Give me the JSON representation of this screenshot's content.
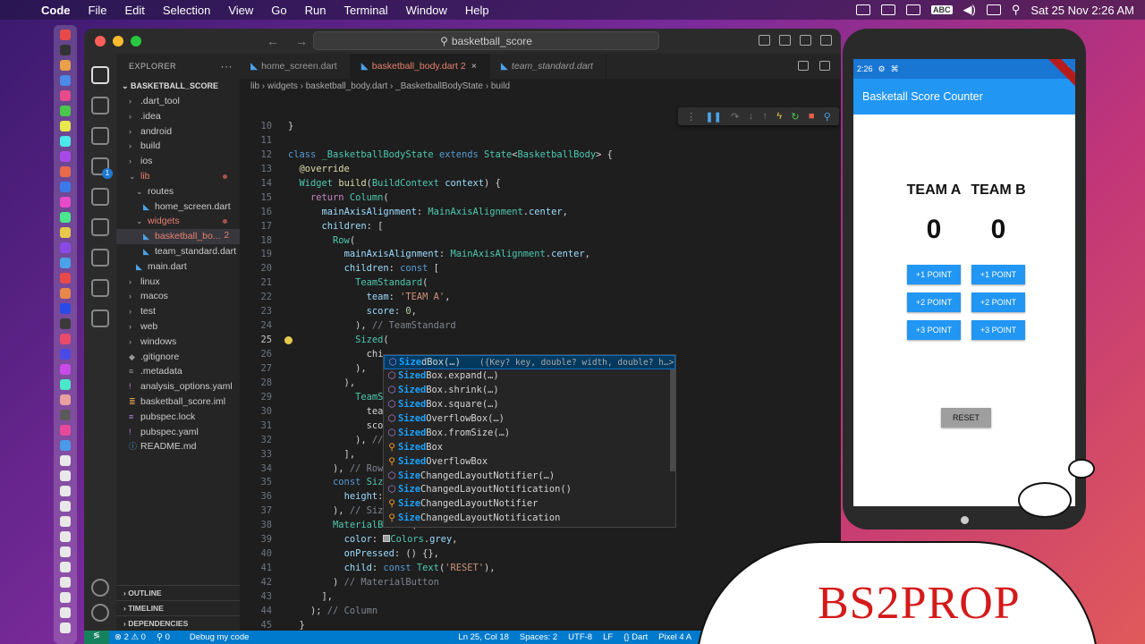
{
  "menubar": {
    "app": "Code",
    "items": [
      "File",
      "Edit",
      "Selection",
      "View",
      "Go",
      "Run",
      "Terminal",
      "Window",
      "Help"
    ],
    "input_source": "ABC",
    "datetime": "Sat 25 Nov  2:26 AM"
  },
  "window": {
    "search": "basketball_score"
  },
  "activity_badge": "1",
  "explorer": {
    "title": "EXPLORER",
    "root": "BASKETBALL_SCORE",
    "items": [
      {
        "label": ".dart_tool",
        "type": "folder",
        "indent": 1
      },
      {
        "label": ".idea",
        "type": "folder",
        "indent": 1
      },
      {
        "label": "android",
        "type": "folder",
        "indent": 1
      },
      {
        "label": "build",
        "type": "folder",
        "indent": 1
      },
      {
        "label": "ios",
        "type": "folder",
        "indent": 1
      },
      {
        "label": "lib",
        "type": "folder-open",
        "indent": 1,
        "modified": true
      },
      {
        "label": "routes",
        "type": "folder-open",
        "indent": 2
      },
      {
        "label": "home_screen.dart",
        "type": "dart",
        "indent": 3
      },
      {
        "label": "widgets",
        "type": "folder-open",
        "indent": 2,
        "modified": true
      },
      {
        "label": "basketball_bo...",
        "type": "dart",
        "indent": 3,
        "selected": true,
        "errors": "2"
      },
      {
        "label": "team_standard.dart",
        "type": "dart",
        "indent": 3
      },
      {
        "label": "main.dart",
        "type": "dart",
        "indent": 2
      },
      {
        "label": "linux",
        "type": "folder",
        "indent": 1
      },
      {
        "label": "macos",
        "type": "folder",
        "indent": 1
      },
      {
        "label": "test",
        "type": "folder",
        "indent": 1
      },
      {
        "label": "web",
        "type": "folder",
        "indent": 1
      },
      {
        "label": "windows",
        "type": "folder",
        "indent": 1
      },
      {
        "label": ".gitignore",
        "type": "git",
        "indent": 1
      },
      {
        "label": ".metadata",
        "type": "meta",
        "indent": 1
      },
      {
        "label": "analysis_options.yaml",
        "type": "yaml",
        "indent": 1
      },
      {
        "label": "basketball_score.iml",
        "type": "iml",
        "indent": 1
      },
      {
        "label": "pubspec.lock",
        "type": "lock",
        "indent": 1
      },
      {
        "label": "pubspec.yaml",
        "type": "yaml",
        "indent": 1
      },
      {
        "label": "README.md",
        "type": "info",
        "indent": 1
      }
    ],
    "sections": [
      "OUTLINE",
      "TIMELINE",
      "DEPENDENCIES"
    ]
  },
  "tabs": [
    {
      "label": "home_screen.dart",
      "active": false,
      "italic": false
    },
    {
      "label": "basketball_body.dart 2",
      "active": true,
      "italic": false
    },
    {
      "label": "team_standard.dart",
      "active": false,
      "italic": true
    }
  ],
  "breadcrumb": [
    "lib",
    "widgets",
    "basketball_body.dart",
    "_BasketballBodyState",
    "build"
  ],
  "code_lines": [
    {
      "n": "10",
      "html": "<span>}</span>"
    },
    {
      "n": "11",
      "html": ""
    },
    {
      "n": "12",
      "html": "<span class='b'>class</span> <span class='t'>_BasketballBodyState</span> <span class='b'>extends</span> <span class='t'>State</span>&lt;<span class='t'>BasketballBody</span>&gt; {"
    },
    {
      "n": "13",
      "html": "  <span class='f'>@override</span>"
    },
    {
      "n": "14",
      "html": "  <span class='t'>Widget</span> <span class='f'>build</span>(<span class='t'>BuildContext</span> <span class='p'>context</span>) {"
    },
    {
      "n": "15",
      "html": "    <span class='k'>return</span> <span class='t'>Column</span>("
    },
    {
      "n": "16",
      "html": "      <span class='p'>mainAxisAlignment</span>: <span class='t'>MainAxisAlignment</span>.<span class='p'>center</span>,"
    },
    {
      "n": "17",
      "html": "      <span class='p'>children</span>: ["
    },
    {
      "n": "18",
      "html": "        <span class='t'>Row</span>("
    },
    {
      "n": "19",
      "html": "          <span class='p'>mainAxisAlignment</span>: <span class='t'>MainAxisAlignment</span>.<span class='p'>center</span>,"
    },
    {
      "n": "20",
      "html": "          <span class='p'>children</span>: <span class='b'>const</span> ["
    },
    {
      "n": "21",
      "html": "            <span class='t'>TeamStandard</span>("
    },
    {
      "n": "22",
      "html": "              <span class='p'>team</span>: <span class='s'>'TEAM A'</span>,"
    },
    {
      "n": "23",
      "html": "              <span class='p'>score</span>: <span class='n'>0</span>,"
    },
    {
      "n": "24",
      "html": "            ), <span class='cm'>// TeamStandard</span>"
    },
    {
      "n": "25",
      "html": "            <span class='t'>Sized</span>("
    },
    {
      "n": "26",
      "html": "              chi"
    },
    {
      "n": "27",
      "html": "            ),"
    },
    {
      "n": "28",
      "html": "          ),"
    },
    {
      "n": "29",
      "html": "            <span class='t'>TeamS</span>"
    },
    {
      "n": "30",
      "html": "              tea"
    },
    {
      "n": "31",
      "html": "              sco"
    },
    {
      "n": "32",
      "html": "            ), <span class='cm'>//</span>"
    },
    {
      "n": "33",
      "html": "          ],"
    },
    {
      "n": "34",
      "html": "        ), <span class='cm'>// Row</span>"
    },
    {
      "n": "35",
      "html": "        <span class='b'>const</span> <span class='t'>Siz</span>"
    },
    {
      "n": "36",
      "html": "          <span class='p'>height</span>:"
    },
    {
      "n": "37",
      "html": "        ), <span class='cm'>// Siz</span>"
    },
    {
      "n": "38",
      "html": "        <span class='t'>MaterialButton</span>("
    },
    {
      "n": "39",
      "html": "          <span class='p'>color</span>: <span style='display:inline-block;width:8px;height:8px;background:#9e9e9e;border:1px solid #ccc;'></span><span class='t'>Colors</span>.<span class='p'>grey</span>,"
    },
    {
      "n": "40",
      "html": "          <span class='p'>onPressed</span>: () {},"
    },
    {
      "n": "41",
      "html": "          <span class='p'>child</span>: <span class='b'>const</span> <span class='t'>Text</span>(<span class='s'>'RESET'</span>),"
    },
    {
      "n": "42",
      "html": "        ) <span class='cm'>// MaterialButton</span>"
    },
    {
      "n": "43",
      "html": "      ],"
    },
    {
      "n": "44",
      "html": "    ); <span class='cm'>// Column</span>"
    },
    {
      "n": "45",
      "html": "  }"
    },
    {
      "n": "46",
      "html": "}"
    }
  ],
  "current_line": "25",
  "suggestions": [
    {
      "match": "Size",
      "rest": "dBox(…)",
      "kind": "method",
      "detail": "({Key? key, double? width, double? h…>",
      "selected": true
    },
    {
      "match": "Sized",
      "rest": "Box.expand(…)",
      "kind": "method"
    },
    {
      "match": "Sized",
      "rest": "Box.shrink(…)",
      "kind": "method"
    },
    {
      "match": "Sized",
      "rest": "Box.square(…)",
      "kind": "method"
    },
    {
      "match": "Sized",
      "rest": "OverflowBox(…)",
      "kind": "method"
    },
    {
      "match": "Sized",
      "rest": "Box.fromSize(…)",
      "kind": "method"
    },
    {
      "match": "Sized",
      "rest": "Box",
      "kind": "class"
    },
    {
      "match": "Sized",
      "rest": "OverflowBox",
      "kind": "class"
    },
    {
      "match": "Size",
      "rest": "ChangedLayoutNotifier(…)",
      "kind": "method"
    },
    {
      "match": "Size",
      "rest": "ChangedLayoutNotification()",
      "kind": "method"
    },
    {
      "match": "Size",
      "rest": "ChangedLayoutNotifier",
      "kind": "class"
    },
    {
      "match": "Size",
      "rest": "ChangedLayoutNotification",
      "kind": "class"
    }
  ],
  "statusbar": {
    "problems": "⊗ 2 ⚠ 0",
    "ports": "⚲ 0",
    "debug": "Debug my code",
    "position": "Ln 25, Col 18",
    "spaces": "Spaces: 2",
    "encoding": "UTF-8",
    "eol": "LF",
    "language": "{} Dart",
    "device": "Pixel 4 A"
  },
  "phone": {
    "time": "2:26",
    "app_title": "Basketall Score Counter",
    "team_a": "TEAM A",
    "team_b": "TEAM B",
    "score_a": "0",
    "score_b": "0",
    "buttons": [
      "+1 POINT",
      "+2 POINT",
      "+3 POINT"
    ],
    "reset": "RESET"
  },
  "watermark": "BS2PROP",
  "colors": {
    "accent": "#007acc",
    "app_bar": "#2196f3",
    "watermark": "#d41a1a"
  }
}
